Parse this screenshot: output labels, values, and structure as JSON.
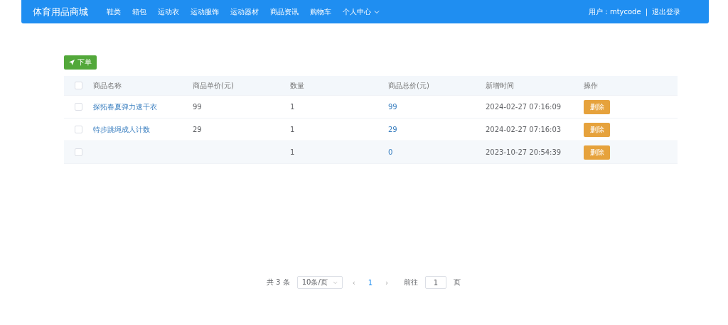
{
  "nav": {
    "brand": "体育用品商城",
    "items": [
      {
        "label": "鞋类",
        "dropdown": false
      },
      {
        "label": "箱包",
        "dropdown": false
      },
      {
        "label": "运动衣",
        "dropdown": false
      },
      {
        "label": "运动服饰",
        "dropdown": false
      },
      {
        "label": "运动器材",
        "dropdown": false
      },
      {
        "label": "商品资讯",
        "dropdown": false
      },
      {
        "label": "购物车",
        "dropdown": false
      },
      {
        "label": "个人中心",
        "dropdown": true
      }
    ],
    "user": "用户：mtycode",
    "separator": "|",
    "logout": "退出登录"
  },
  "order_button": "下单",
  "table": {
    "all_checked": false,
    "columns": [
      "商品名称",
      "商品单价(元)",
      "数量",
      "商品总价(元)",
      "新增时间",
      "操作"
    ],
    "rows": [
      {
        "checked": false,
        "name": "探拓春夏弹力速干衣",
        "price": "99",
        "qty": "1",
        "total": "99",
        "time": "2024-02-27 07:16:09",
        "action": "删除"
      },
      {
        "checked": false,
        "name": "特步跳绳成人计数",
        "price": "29",
        "qty": "1",
        "total": "29",
        "time": "2024-02-27 07:16:03",
        "action": "删除"
      },
      {
        "checked": false,
        "name": "",
        "price": "",
        "qty": "1",
        "total": "0",
        "time": "2023-10-27 20:54:39",
        "action": "删除"
      }
    ]
  },
  "pagination": {
    "total": "共 3 条",
    "page_size": "10条/页",
    "prev": "‹",
    "pages": [
      {
        "label": "1",
        "selected": true
      }
    ],
    "next": "›",
    "goto_label": "前往",
    "goto_value": "1",
    "goto_suffix": "页"
  }
}
